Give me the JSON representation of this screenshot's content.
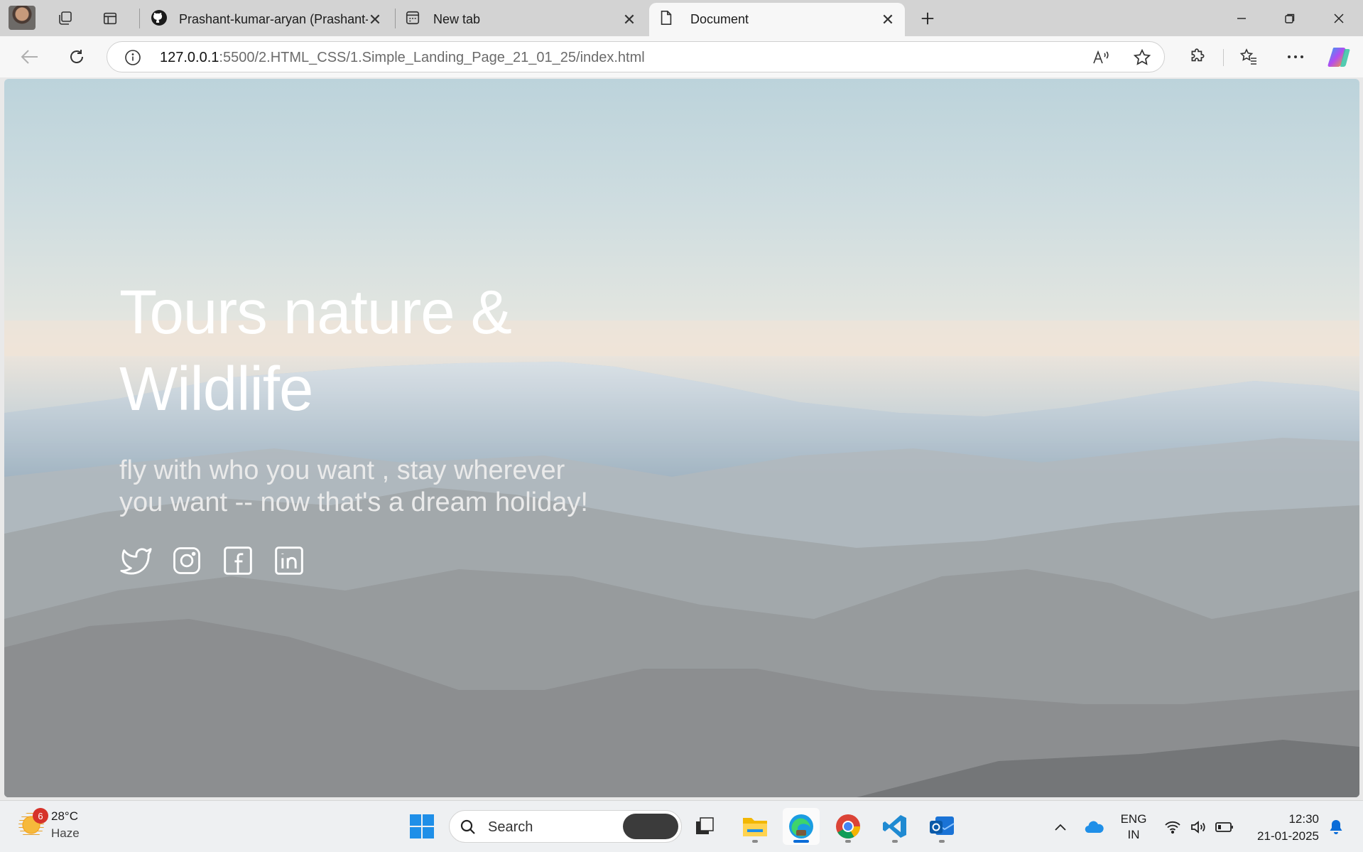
{
  "browser": {
    "tabs": [
      {
        "title": "Prashant-kumar-aryan (Prashant-k",
        "icon": "github-icon",
        "active": false
      },
      {
        "title": "New tab",
        "icon": "new-tab-page-icon",
        "active": false
      },
      {
        "title": "Document",
        "icon": "document-icon",
        "active": true
      }
    ],
    "url_host": "127.0.0.1",
    "url_path": ":5500/2.HTML_CSS/1.Simple_Landing_Page_21_01_25/index.html"
  },
  "page": {
    "title_line1": "Tours nature &",
    "title_line2": "Wildlife",
    "subtitle": "fly with who you want , stay wherever you want -- now that's a dream holiday!",
    "socials": [
      "twitter-icon",
      "instagram-icon",
      "facebook-icon",
      "linkedin-icon"
    ]
  },
  "taskbar": {
    "weather_temp": "28°C",
    "weather_condition": "Haze",
    "weather_badge": "6",
    "search_placeholder": "Search",
    "lang_line1": "ENG",
    "lang_line2": "IN",
    "time": "12:30",
    "date": "21-01-2025"
  },
  "colors": {
    "accent": "#0a6cd8",
    "hero_text": "#ffffff"
  }
}
